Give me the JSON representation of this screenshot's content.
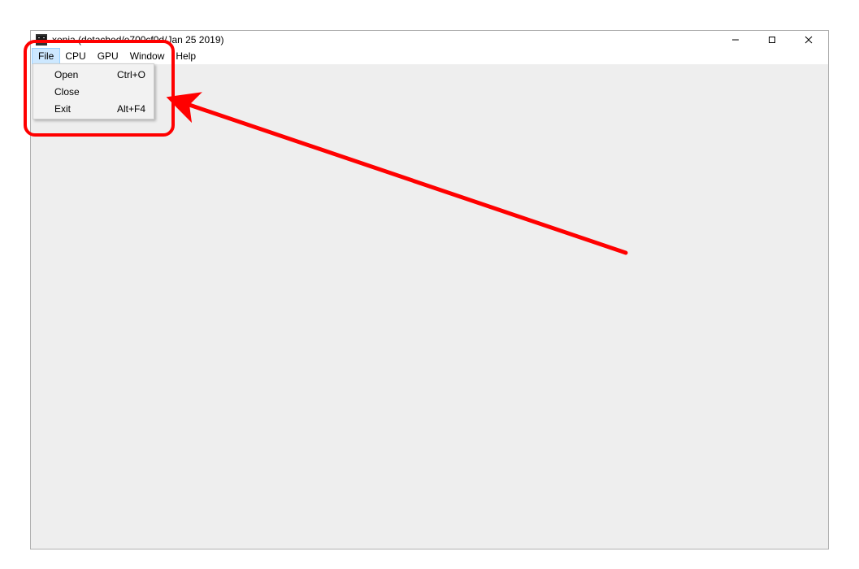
{
  "window": {
    "title": "xenia (detached/e700cf0d/Jan 25 2019)"
  },
  "menubar": {
    "items": [
      "File",
      "CPU",
      "GPU",
      "Window",
      "Help"
    ],
    "activeIndex": 0
  },
  "dropdown": {
    "items": [
      {
        "label": "Open",
        "shortcut": "Ctrl+O"
      },
      {
        "label": "Close",
        "shortcut": ""
      },
      {
        "label": "Exit",
        "shortcut": "Alt+F4"
      }
    ]
  },
  "annotation": {
    "color": "#ff0000"
  }
}
